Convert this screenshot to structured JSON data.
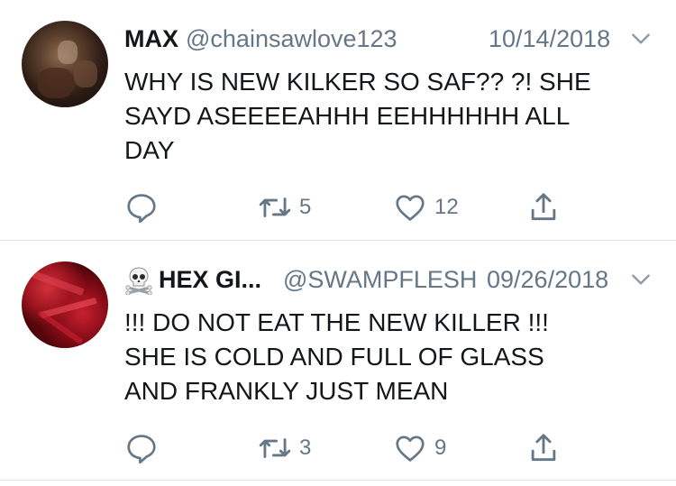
{
  "tweets": [
    {
      "display_name": "MAX",
      "handle": "@chainsawlove123",
      "date": "10/14/2018",
      "text": "WHY IS NEW KILKER SO SAF?? ?! SHE\nSAYD ASEEEEAHHH EEHHHHHH ALL\nDAY",
      "retweets": "5",
      "likes": "12",
      "avatar_icon": "user-avatar-max",
      "name_prefix_icon": ""
    },
    {
      "display_name": "HEX GI...",
      "handle": "@SWAMPFLESH",
      "date": "09/26/2018",
      "text": "!!! DO NOT EAT THE NEW KILLER !!!\nSHE IS COLD AND FULL OF GLASS\nAND FRANKLY JUST MEAN",
      "retweets": "3",
      "likes": "9",
      "avatar_icon": "user-avatar-hex",
      "name_prefix_icon": "skull-crossbones-icon"
    }
  ],
  "colors": {
    "text_primary": "#14171a",
    "text_secondary": "#657786",
    "icon": "#657786",
    "divider": "#dfe3e6"
  }
}
